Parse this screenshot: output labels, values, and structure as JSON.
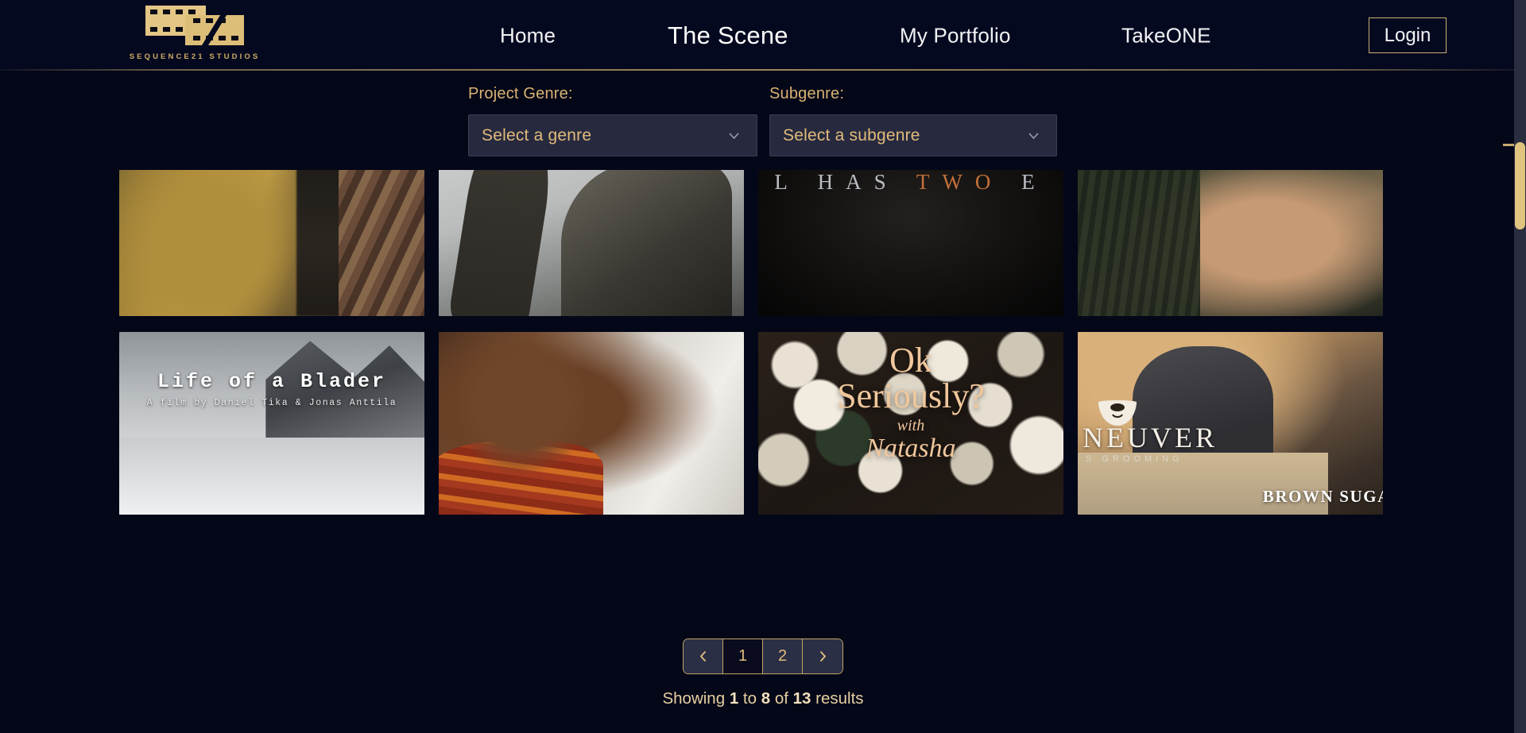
{
  "brand": {
    "logo_icon": "film-strip-icon",
    "wordmark": "SEQUENCE21 STUDIOS",
    "gold": "#cdab63"
  },
  "header": {
    "nav": [
      {
        "label": "Home",
        "key": "home",
        "active": false
      },
      {
        "label": "The Scene",
        "key": "scene",
        "active": true
      },
      {
        "label": "My Portfolio",
        "key": "portfolio",
        "active": false
      },
      {
        "label": "TakeONE",
        "key": "takeone",
        "active": false
      }
    ],
    "login_label": "Login"
  },
  "filters": {
    "genre": {
      "label": "Project Genre:",
      "value": "Select a genre",
      "icon": "chevron-down-icon"
    },
    "subgenre": {
      "label": "Subgenre:",
      "value": "Select a subgenre",
      "icon": "chevron-down-icon"
    }
  },
  "grid": {
    "cards": [
      {
        "id": 1,
        "alt": "Two people in winter coats outdoors",
        "overlay_text": ""
      },
      {
        "id": 2,
        "alt": "Man holding an axe against grey sky",
        "overlay_text": ""
      },
      {
        "id": 3,
        "alt": "Dark title card",
        "overlay_text": "L  HAS  TWO  E",
        "overlay_pre": "L  HAS  ",
        "overlay_hl": "TWO",
        "overlay_post": "  E"
      },
      {
        "id": 4,
        "alt": "Young man with glasses looking up in forest",
        "overlay_text": ""
      },
      {
        "id": 5,
        "alt": "Snowy street with houses",
        "title": "Life of a Blader",
        "credit": "A film by Daniel Tika & Jonas Anttila"
      },
      {
        "id": 6,
        "alt": "Man in red striped jacket",
        "overlay_text": ""
      },
      {
        "id": 7,
        "alt": "Bokeh christmas lights title card",
        "line1": "Ok",
        "line2": "Seriously?",
        "line3": "with",
        "line4": "Natasha"
      },
      {
        "id": 8,
        "alt": "Barbershop interior",
        "brand_icon": "beard-icon",
        "brand_word": "NEUVER",
        "brand_sub": "S  GROOMING",
        "caption": "BROWN SUGA"
      }
    ]
  },
  "pagination": {
    "prev_icon": "chevron-left-icon",
    "next_icon": "chevron-right-icon",
    "pages": [
      {
        "label": "1",
        "current": true
      },
      {
        "label": "2",
        "current": false
      }
    ],
    "showing": {
      "prefix": "Showing ",
      "from": "1",
      "mid1": " to ",
      "to": "8",
      "mid2": " of ",
      "total": "13",
      "suffix": " results"
    }
  },
  "scrollbar": {
    "orientation": "vertical",
    "thumb_color": "#e0c47f"
  }
}
